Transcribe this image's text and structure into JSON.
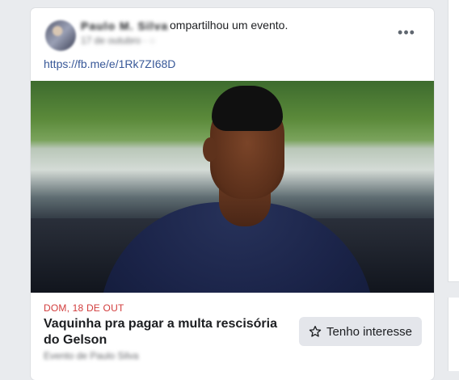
{
  "post": {
    "author_name": "Paulo M. Silva",
    "shared_prefix": "ompartilhou um ",
    "shared_object": "evento",
    "shared_suffix": ".",
    "meta": "17 de outubro · ◌",
    "link_text": "https://fb.me/e/1Rk7ZI68D",
    "more_icon": "more-options-icon"
  },
  "event": {
    "date": "DOM, 18 DE OUT",
    "title": "Vaquinha pra pagar a multa rescisória do Gelson",
    "meta": "Evento de Paulo Silva",
    "interest_label": "Tenho interesse",
    "interest_icon": "star-outline-icon"
  },
  "colors": {
    "link": "#385898",
    "date": "#d23c3c",
    "button_bg": "#e4e6eb"
  }
}
